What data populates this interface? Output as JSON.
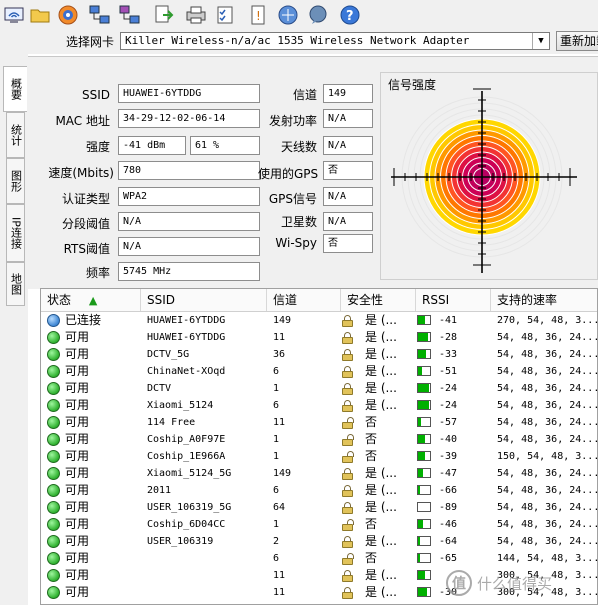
{
  "toolbar": {
    "icons": [
      "wifi-computer-icon",
      "folder-icon",
      "globe-icon",
      "network-icon",
      "network-share-icon",
      "export-icon",
      "print-icon",
      "checklist-icon",
      "info-card-icon",
      "globe-arrow-icon",
      "chat-icon",
      "help-icon"
    ]
  },
  "adapter": {
    "label": "选择网卡",
    "selected": "Killer Wireless-n/a/ac 1535 Wireless Network Adapter",
    "refresh_label": "重新加载"
  },
  "side_tabs": [
    "概要",
    "统计",
    "图形",
    "IP连接",
    "地图"
  ],
  "details": {
    "ssid_label": "SSID",
    "ssid": "HUAWEI-6YTDDG",
    "mac_label": "MAC 地址",
    "mac": "34-29-12-02-06-14",
    "strength_label": "强度",
    "strength_dbm": "-41 dBm",
    "strength_pct": "61 %",
    "speed_label": "速度(Mbits)",
    "speed": "780",
    "auth_label": "认证类型",
    "auth": "WPA2",
    "frag_label": "分段阈值",
    "frag": "N/A",
    "rts_label": "RTS阈值",
    "rts": "N/A",
    "freq_label": "频率",
    "freq": "5745 MHz",
    "channel_label": "信道",
    "channel": "149",
    "txpower_label": "发射功率",
    "txpower": "N/A",
    "antenna_label": "天线数",
    "antenna": "N/A",
    "gps_used_label": "使用的GPS",
    "gps_used": "否",
    "gps_signal_label": "GPS信号",
    "gps_signal": "N/A",
    "satellite_label": "卫星数",
    "satellite": "N/A",
    "wispy_label": "Wi-Spy",
    "wispy": "否"
  },
  "signal": {
    "title": "信号强度",
    "ring_colors": [
      "#ffd700",
      "#ffc800",
      "#ff9900",
      "#ff7700",
      "#ff5522",
      "#f23333",
      "#dd1144",
      "#cc0055",
      "#c0005a",
      "#b80060"
    ]
  },
  "table": {
    "columns": [
      "状态",
      "SSID",
      "信道",
      "安全性",
      "RSSI",
      "支持的速率"
    ],
    "rows": [
      {
        "status": "已连接",
        "ssid": "HUAWEI-6YTDDG",
        "channel": "149",
        "secured": true,
        "security": "是 (...",
        "rssi": "-41",
        "rssi_level": 0.55,
        "rates": "270, 54, 48, 3..."
      },
      {
        "status": "可用",
        "ssid": "HUAWEI-6YTDDG",
        "channel": "11",
        "secured": true,
        "security": "是 (...",
        "rssi": "-28",
        "rssi_level": 0.8,
        "rates": "54, 48, 36, 24..."
      },
      {
        "status": "可用",
        "ssid": "DCTV_5G",
        "channel": "36",
        "secured": true,
        "security": "是 (...",
        "rssi": "-33",
        "rssi_level": 0.7,
        "rates": "54, 48, 36, 24..."
      },
      {
        "status": "可用",
        "ssid": "ChinaNet-XOqd",
        "channel": "6",
        "secured": true,
        "security": "是 (...",
        "rssi": "-51",
        "rssi_level": 0.35,
        "rates": "54, 48, 36, 24..."
      },
      {
        "status": "可用",
        "ssid": "DCTV",
        "channel": "1",
        "secured": true,
        "security": "是 (...",
        "rssi": "-24",
        "rssi_level": 0.9,
        "rates": "54, 48, 36, 24..."
      },
      {
        "status": "可用",
        "ssid": "Xiaomi_5124",
        "channel": "6",
        "secured": true,
        "security": "是 (...",
        "rssi": "-24",
        "rssi_level": 0.9,
        "rates": "54, 48, 36, 24..."
      },
      {
        "status": "可用",
        "ssid": "114 Free",
        "channel": "11",
        "secured": false,
        "security": "否",
        "rssi": "-57",
        "rssi_level": 0.25,
        "rates": "54, 48, 36, 24..."
      },
      {
        "status": "可用",
        "ssid": "Coship_A0F97E",
        "channel": "1",
        "secured": false,
        "security": "否",
        "rssi": "-40",
        "rssi_level": 0.55,
        "rates": "54, 48, 36, 24..."
      },
      {
        "status": "可用",
        "ssid": "Coship_1E966A",
        "channel": "1",
        "secured": false,
        "security": "否",
        "rssi": "-39",
        "rssi_level": 0.55,
        "rates": "150, 54, 48, 3..."
      },
      {
        "status": "可用",
        "ssid": "Xiaomi_5124_5G",
        "channel": "149",
        "secured": true,
        "security": "是 (...",
        "rssi": "-47",
        "rssi_level": 0.45,
        "rates": "54, 48, 36, 24..."
      },
      {
        "status": "可用",
        "ssid": "2011",
        "channel": "6",
        "secured": true,
        "security": "是 (...",
        "rssi": "-66",
        "rssi_level": 0.15,
        "rates": "54, 48, 36, 24..."
      },
      {
        "status": "可用",
        "ssid": "USER_106319_5G",
        "channel": "64",
        "secured": true,
        "security": "是 (...",
        "rssi": "-89",
        "rssi_level": 0.0,
        "rates": "54, 48, 36, 24..."
      },
      {
        "status": "可用",
        "ssid": "Coship_6D04CC",
        "channel": "1",
        "secured": false,
        "security": "否",
        "rssi": "-46",
        "rssi_level": 0.45,
        "rates": "54, 48, 36, 24..."
      },
      {
        "status": "可用",
        "ssid": "USER_106319",
        "channel": "2",
        "secured": true,
        "security": "是 (...",
        "rssi": "-64",
        "rssi_level": 0.15,
        "rates": "54, 48, 36, 24..."
      },
      {
        "status": "可用",
        "ssid": "",
        "channel": "6",
        "secured": false,
        "security": "否",
        "rssi": "-65",
        "rssi_level": 0.15,
        "rates": "144, 54, 48, 3..."
      },
      {
        "status": "可用",
        "ssid": "",
        "channel": "11",
        "secured": true,
        "security": "是 (...",
        "rssi": "",
        "rssi_level": 0.6,
        "rates": "300, 54, 48, 3..."
      },
      {
        "status": "可用",
        "ssid": "",
        "channel": "11",
        "secured": true,
        "security": "是 (...",
        "rssi": "-30",
        "rssi_level": 0.75,
        "rates": "300, 54, 48, 3..."
      }
    ]
  },
  "watermark": {
    "logo": "值",
    "text": "什么值得买"
  }
}
